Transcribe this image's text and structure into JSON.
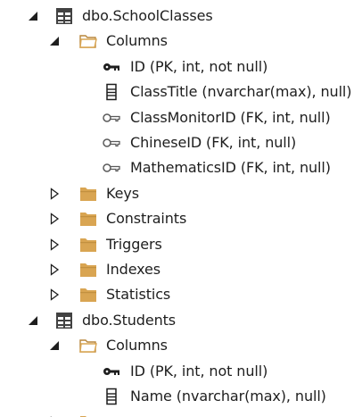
{
  "tree": {
    "school_classes": {
      "label": "dbo.SchoolClasses",
      "columns_label": "Columns",
      "columns": [
        {
          "label": "ID (PK, int, not null)",
          "icon": "primary-key-icon"
        },
        {
          "label": "ClassTitle (nvarchar(max), null)",
          "icon": "column-icon"
        },
        {
          "label": "ClassMonitorID (FK, int, null)",
          "icon": "foreign-key-icon"
        },
        {
          "label": "ChineseID (FK, int, null)",
          "icon": "foreign-key-icon"
        },
        {
          "label": "MathematicsID (FK, int, null)",
          "icon": "foreign-key-icon"
        }
      ],
      "folders": [
        "Keys",
        "Constraints",
        "Triggers",
        "Indexes",
        "Statistics"
      ]
    },
    "students": {
      "label": "dbo.Students",
      "columns_label": "Columns",
      "columns": [
        {
          "label": "ID (PK, int, not null)",
          "icon": "primary-key-icon"
        },
        {
          "label": "Name (nvarchar(max), null)",
          "icon": "column-icon"
        }
      ]
    }
  },
  "colors": {
    "folder": "#d9a552",
    "folder_dark": "#b8863b",
    "table_icon": "#424242",
    "text": "#1e1e1e"
  }
}
